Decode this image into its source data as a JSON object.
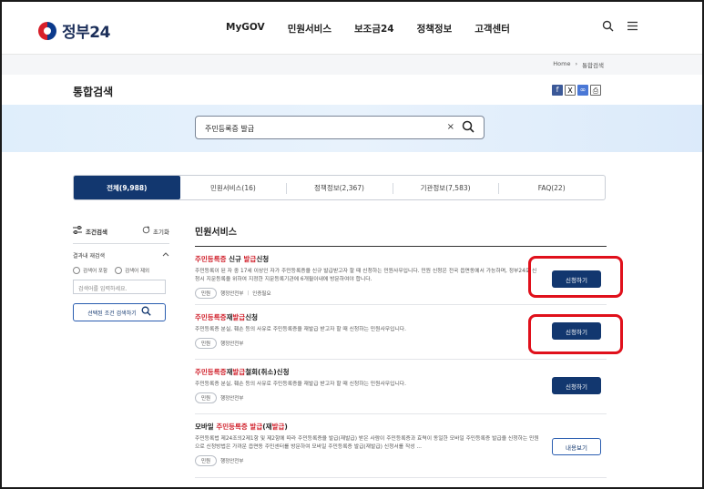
{
  "header": {
    "logo_text": "정부24",
    "nav": [
      "MyGOV",
      "민원서비스",
      "보조금24",
      "정책정보",
      "고객센터"
    ]
  },
  "breadcrumb": {
    "home": "Home",
    "sep": "›",
    "current": "통합검색"
  },
  "page": {
    "title": "통합검색"
  },
  "search": {
    "value": "주민등록증 발급",
    "clear": "×"
  },
  "tabs": [
    "전체(9,988)",
    "민원서비스(16)",
    "정책정보(2,367)",
    "기관정보(7,583)",
    "FAQ(22)"
  ],
  "filter": {
    "title": "조건검색",
    "reset": "초기화",
    "subtitle": "결과내 재검색",
    "include": "검색어 포함",
    "exclude": "검색어 제외",
    "input_placeholder": "검색어를 입력하세요.",
    "apply": "선택된 조건 검색하기"
  },
  "results": {
    "section_title": "민원서비스",
    "items": [
      {
        "title_parts": [
          {
            "t": "주민등록증",
            "hl": true
          },
          {
            "t": " 신규 ",
            "hl": false
          },
          {
            "t": "발급",
            "hl": true
          },
          {
            "t": "신청",
            "hl": false
          }
        ],
        "desc": "주민등록이 된 자 중 17세 이상인 자가 주민등록증을 신규 발급받고자 할 때 신청하는 민원사무입니다. 민원 신청은 전국 읍면동에서 가능하며, 정부24로 신청시 지문등록을 위하여 지정한 지문등록기관에 6개월이내에 방문하여야 합니다.",
        "tags": [
          "민원",
          "행정안전부",
          "인증필요"
        ],
        "button": "신청하기"
      },
      {
        "title_parts": [
          {
            "t": "주민등록증",
            "hl": true
          },
          {
            "t": "재",
            "hl": false
          },
          {
            "t": "발급",
            "hl": true
          },
          {
            "t": "신청",
            "hl": false
          }
        ],
        "desc": "주민등록증 분실, 훼손 등의 사유로 주민등록증을 재발급 받고자 할 때 신청하는 민원사무입니다.",
        "tags": [
          "민원",
          "행정안전부"
        ],
        "button": "신청하기"
      },
      {
        "title_parts": [
          {
            "t": "주민등록증",
            "hl": true
          },
          {
            "t": "재",
            "hl": false
          },
          {
            "t": "발급",
            "hl": true
          },
          {
            "t": "철회(취소)신청",
            "hl": false
          }
        ],
        "desc": "주민등록증 분실, 훼손 등의 사유로 주민등록증을 재발급 받고자 할 때 신청하는 민원사무입니다.",
        "tags": [
          "민원",
          "행정안전부"
        ],
        "button": "신청하기"
      },
      {
        "title_parts": [
          {
            "t": "모바일 ",
            "hl": false
          },
          {
            "t": "주민등록증 발급",
            "hl": true
          },
          {
            "t": "(재",
            "hl": false
          },
          {
            "t": "발급",
            "hl": true
          },
          {
            "t": ")",
            "hl": false
          }
        ],
        "desc": "주민등록법 제24조의2제1항 및 제2항에 따라 주민등록증을 발급(재발급) 받은 사람이 주민등록증과 효력이 동일한 모바일 주민등록증 발급을 신청하는 민원으로 신청방법은 가까운 읍면동 주민센터를 방문하여 모바일 주민등록증 발급(재발급) 신청서를 작성 ...",
        "tags": [
          "민원",
          "행정안전부"
        ],
        "button": "내용보기"
      }
    ]
  },
  "colors": {
    "primary": "#12376f",
    "highlight": "#d0202b",
    "annotation": "#e0101b"
  }
}
